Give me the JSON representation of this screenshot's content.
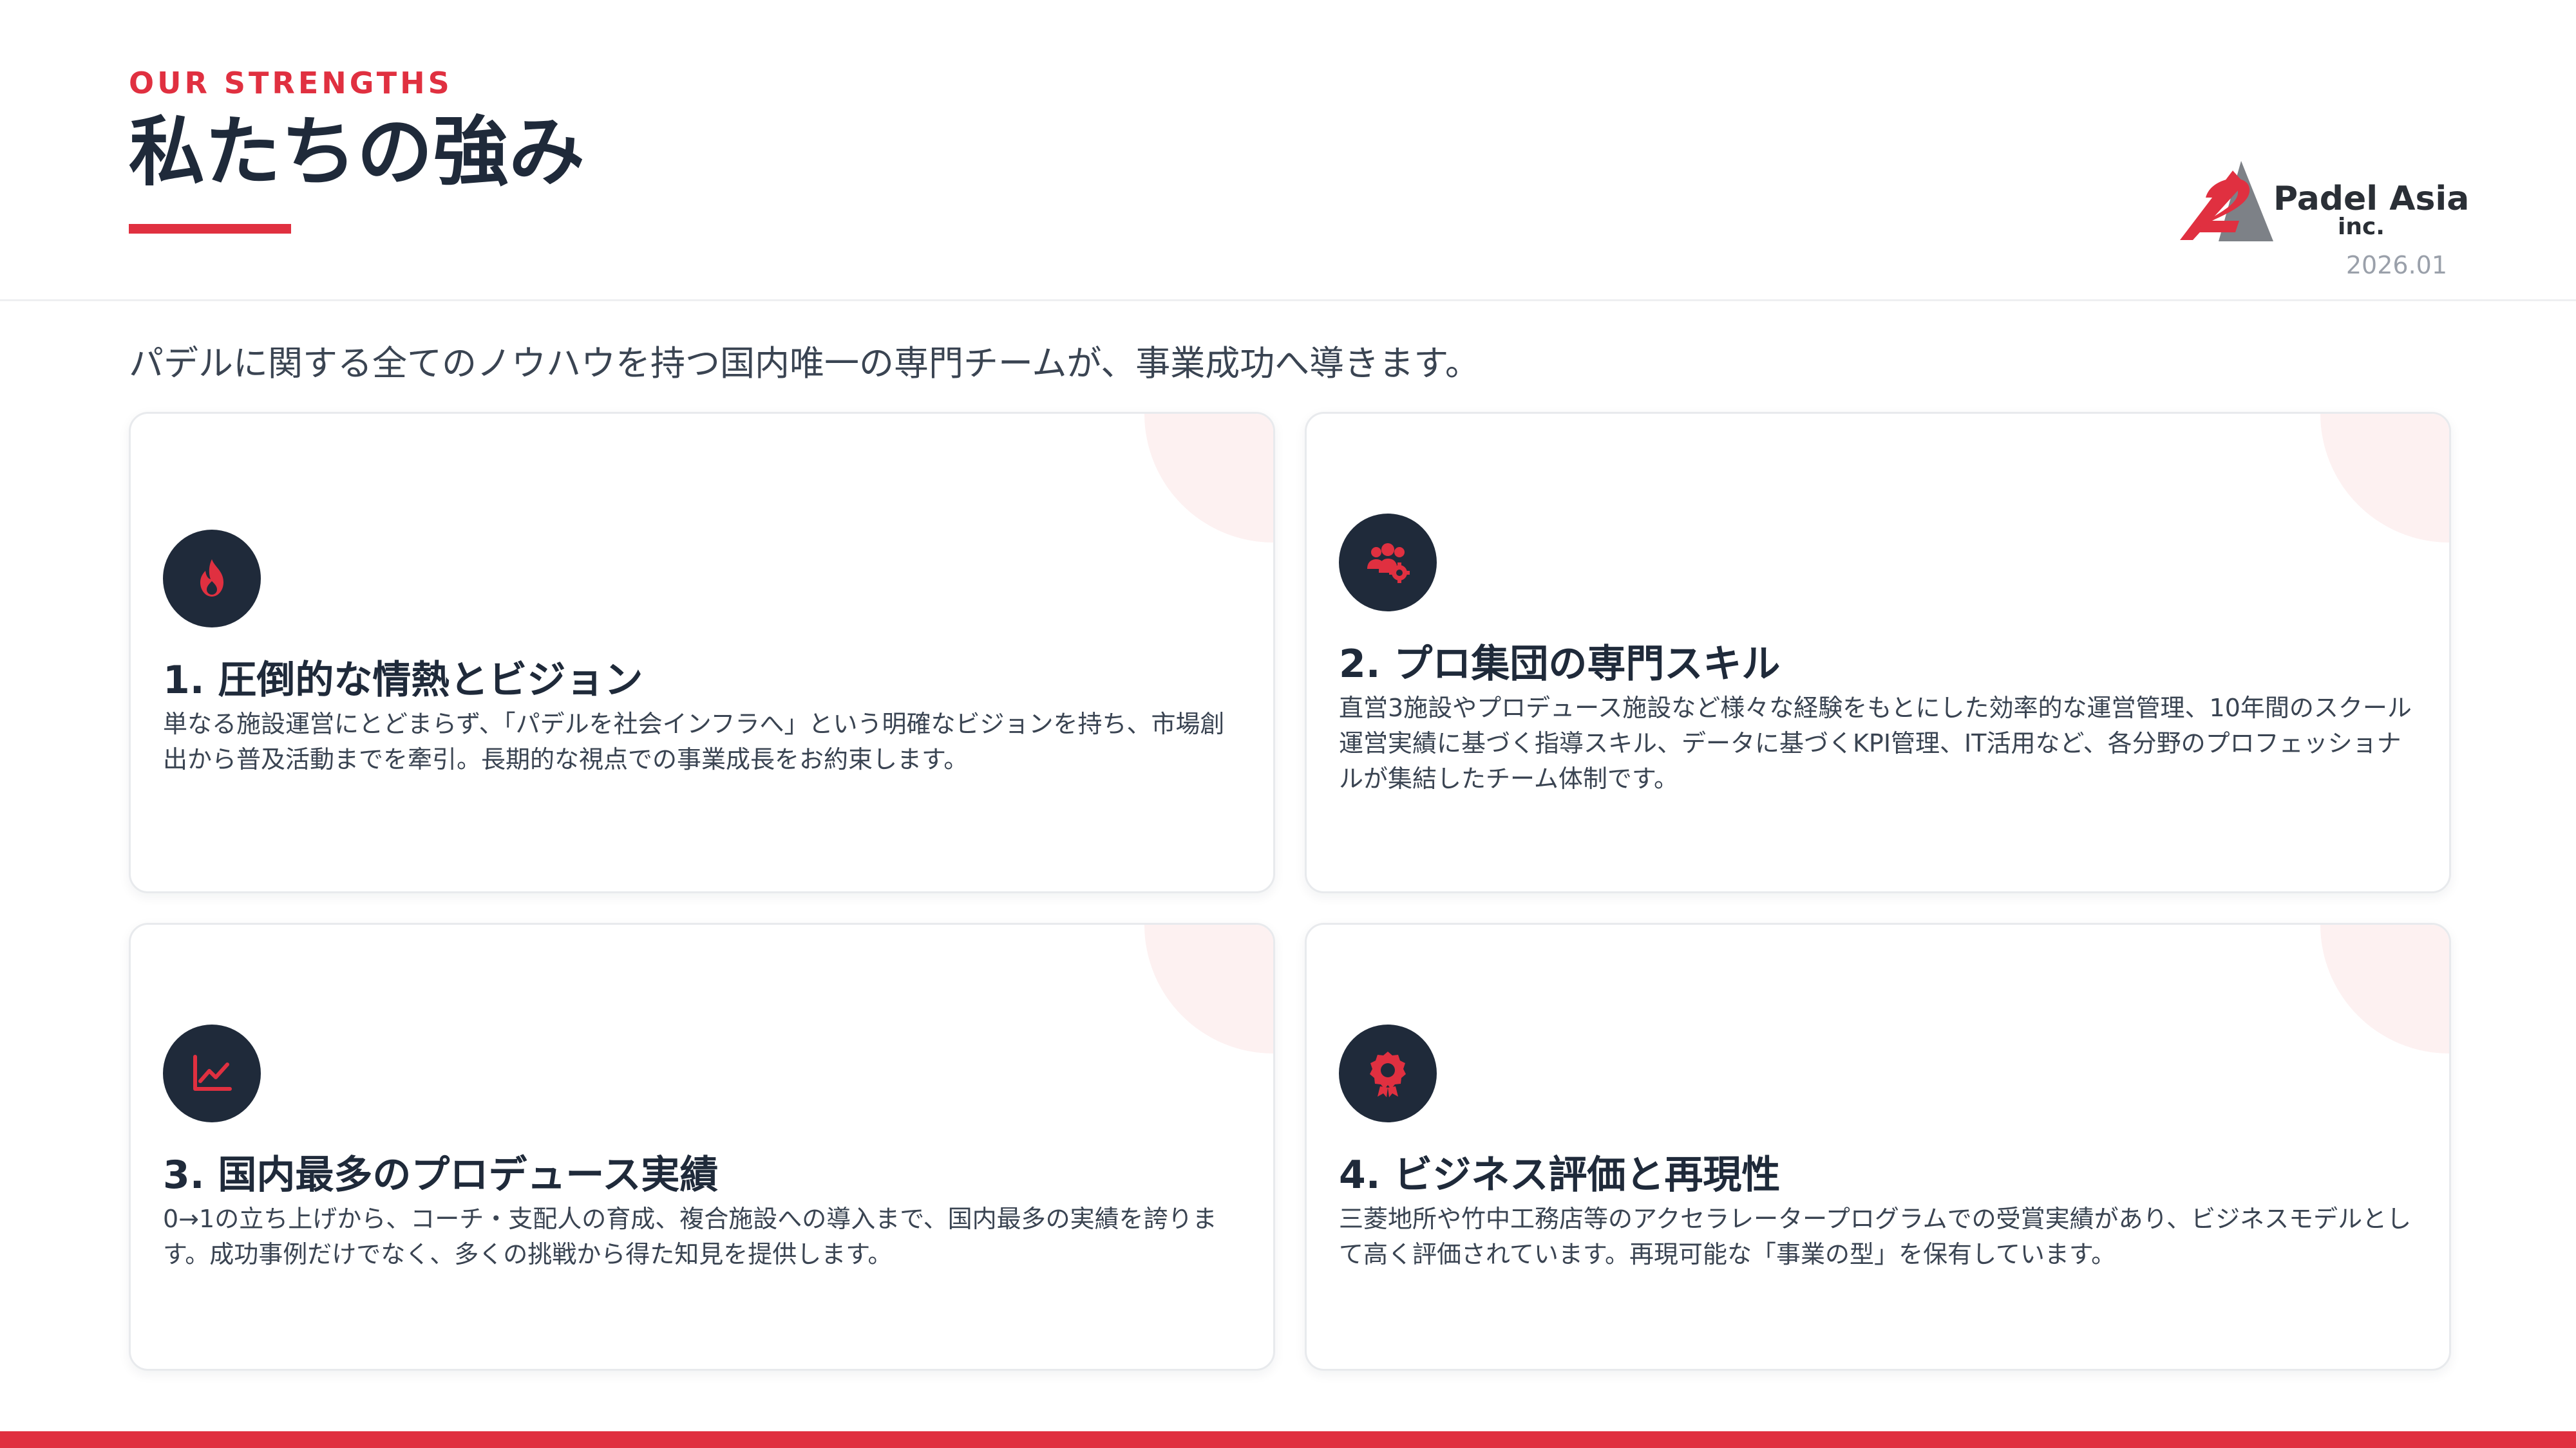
{
  "header": {
    "eyebrow": "OUR STRENGTHS",
    "title": "私たちの強み",
    "date": "2026.01"
  },
  "logo": {
    "name": "Padel Asia",
    "sub": "inc."
  },
  "lead": "パデルに関する全てのノウハウを持つ国内唯一の専門チームが、事業成功へ導きます。",
  "cards": [
    {
      "icon": "flame-icon",
      "title": "1. 圧倒的な情熱とビジョン",
      "desc": "単なる施設運営にとどまらず、「パデルを社会インフラへ」という明確なビジョンを持ち、市場創出から普及活動までを牽引。長期的な視点での事業成長をお約束します。"
    },
    {
      "icon": "team-gear-icon",
      "title": "2. プロ集団の専門スキル",
      "desc": "直営3施設やプロデュース施設など様々な経験をもとにした効率的な運営管理、10年間のスクール運営実績に基づく指導スキル、データに基づくKPI管理、IT活用など、各分野のプロフェッショナルが集結したチーム体制です。"
    },
    {
      "icon": "line-chart-icon",
      "title": "3. 国内最多のプロデュース実績",
      "desc": "0→1の立ち上げから、コーチ・支配人の育成、複合施設への導入まで、国内最多の実績を誇ります。成功事例だけでなく、多くの挑戦から得た知見を提供します。"
    },
    {
      "icon": "award-icon",
      "title": "4. ビジネス評価と再現性",
      "desc": "三菱地所や竹中工務店等のアクセラレータープログラムでの受賞実績があり、ビジネスモデルとして高く評価されています。再現可能な「事業の型」を保有しています。"
    }
  ],
  "colors": {
    "accent": "#e03040",
    "navy": "#1f2a3a",
    "text": "#3a4452",
    "muted": "#9aa0aa"
  }
}
